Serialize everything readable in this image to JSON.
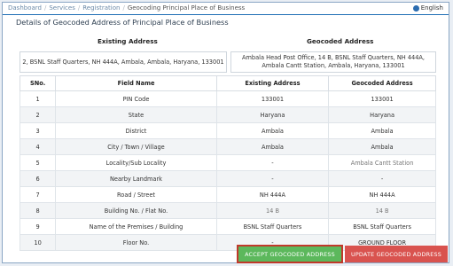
{
  "breadcrumb": [
    "Dashboard",
    "Services",
    "Registration",
    "Geocoding Principal Place of Business"
  ],
  "language": "English",
  "section_title": "Details of Geocoded Address of Principal Place of Business",
  "existing_address_header": "Existing Address",
  "geocoded_address_header": "Geocoded Address",
  "existing_address": "2, BSNL Staff Quarters, NH 444A, Ambala, Ambala, Haryana, 133001",
  "geocoded_address_line1": "Ambala Head Post Office, 14 B, BSNL Staff Quarters, NH 444A,",
  "geocoded_address_line2": "Ambala Cantt Station, Ambala, Haryana, 133001",
  "table": {
    "headers": [
      "SNo.",
      "Field Name",
      "Existing Address",
      "Geocoded Address"
    ],
    "rows": [
      [
        "1",
        "PIN Code",
        "133001",
        "133001"
      ],
      [
        "2",
        "State",
        "Haryana",
        "Haryana"
      ],
      [
        "3",
        "District",
        "Ambala",
        "Ambala"
      ],
      [
        "4",
        "City / Town / Village",
        "Ambala",
        "Ambala"
      ],
      [
        "5",
        "Locality/Sub Locality",
        "-",
        "Ambala Cantt Station"
      ],
      [
        "6",
        "Nearby Landmark",
        "-",
        "-"
      ],
      [
        "7",
        "Road / Street",
        "NH 444A",
        "NH 444A"
      ],
      [
        "8",
        "Building No. / Flat No.",
        "14 B",
        "14 B"
      ],
      [
        "9",
        "Name of the Premises / Building",
        "BSNL Staff Quarters",
        "BSNL Staff Quarters"
      ],
      [
        "10",
        "Floor No.",
        "-",
        "GROUND FLOOR"
      ]
    ]
  },
  "buttons": {
    "accept": "ACCEPT GEOCODED ADDRESS",
    "update": "UPDATE GEOCODED ADDRESS"
  },
  "colors": {
    "accept": "#5cb85c",
    "update": "#d9534f",
    "accent": "#1f6fb5"
  }
}
